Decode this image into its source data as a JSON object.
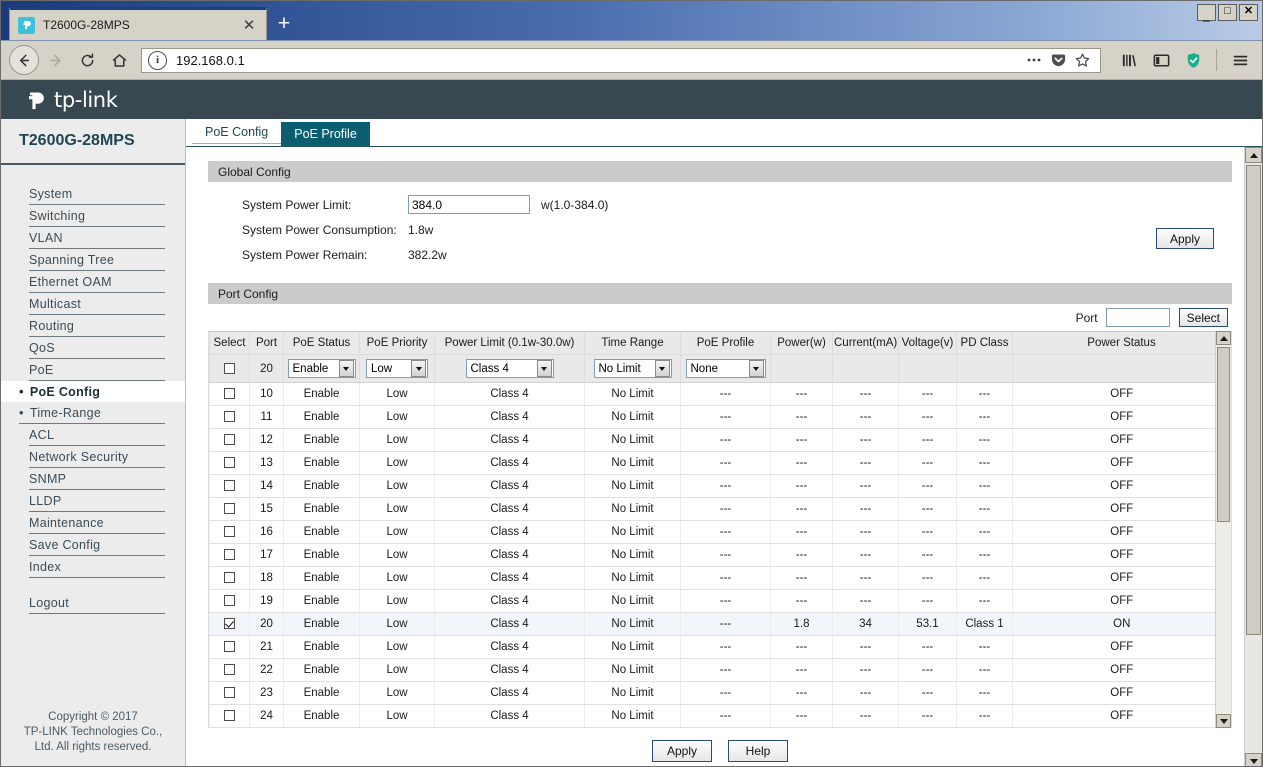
{
  "browser": {
    "tab_title": "T2600G-28MPS",
    "tab_close": "✕",
    "new_tab": "+",
    "url": "192.168.0.1",
    "minimize": "–",
    "maximize": "□",
    "close": "✕"
  },
  "brand": {
    "wordmark": "tp-link"
  },
  "sidebar": {
    "device_name": "T2600G-28MPS",
    "items": [
      {
        "label": "System",
        "type": "top"
      },
      {
        "label": "Switching",
        "type": "top"
      },
      {
        "label": "VLAN",
        "type": "top"
      },
      {
        "label": "Spanning Tree",
        "type": "top"
      },
      {
        "label": "Ethernet OAM",
        "type": "top"
      },
      {
        "label": "Multicast",
        "type": "top"
      },
      {
        "label": "Routing",
        "type": "top"
      },
      {
        "label": "QoS",
        "type": "top"
      },
      {
        "label": "PoE",
        "type": "top"
      },
      {
        "label": "PoE Config",
        "type": "sub-active",
        "bullet": "•"
      },
      {
        "label": "Time-Range",
        "type": "sub",
        "bullet": "•"
      },
      {
        "label": "ACL",
        "type": "top"
      },
      {
        "label": "Network Security",
        "type": "top"
      },
      {
        "label": "SNMP",
        "type": "top"
      },
      {
        "label": "LLDP",
        "type": "top"
      },
      {
        "label": "Maintenance",
        "type": "top"
      },
      {
        "label": "Save Config",
        "type": "top"
      },
      {
        "label": "Index",
        "type": "top"
      },
      {
        "label": "Logout",
        "type": "top-gap"
      }
    ],
    "copyright": "Copyright © 2017\nTP-LINK Technologies Co.,\nLtd. All rights reserved."
  },
  "tabs": [
    {
      "label": "PoE Config",
      "active": false
    },
    {
      "label": "PoE Profile",
      "active": true
    }
  ],
  "global_config": {
    "title": "Global Config",
    "power_limit_label": "System Power Limit:",
    "power_limit_value": "384.0",
    "power_limit_unit": "w(1.0-384.0)",
    "consumption_label": "System Power Consumption:",
    "consumption_value": "1.8w",
    "remain_label": "System Power Remain:",
    "remain_value": "382.2w",
    "apply_label": "Apply"
  },
  "port_config": {
    "title": "Port Config",
    "search_label": "Port",
    "search_value": "",
    "select_label": "Select",
    "columns": [
      "Select",
      "Port",
      "PoE Status",
      "PoE Priority",
      "Power Limit (0.1w-30.0w)",
      "Time Range",
      "PoE Profile",
      "Power(w)",
      "Current(mA)",
      "Voltage(v)",
      "PD Class",
      "Power Status"
    ],
    "edit_row": {
      "checked": false,
      "port": "20",
      "poe_status": "Enable",
      "poe_priority": "Low",
      "power_limit": "Class 4",
      "time_range": "No Limit",
      "poe_profile": "None"
    },
    "rows": [
      {
        "checked": false,
        "port": "10",
        "poe_status": "Enable",
        "poe_priority": "Low",
        "power_limit": "Class 4",
        "time_range": "No Limit",
        "poe_profile": "---",
        "power": "---",
        "current": "---",
        "voltage": "---",
        "pd_class": "---",
        "power_status": "OFF"
      },
      {
        "checked": false,
        "port": "11",
        "poe_status": "Enable",
        "poe_priority": "Low",
        "power_limit": "Class 4",
        "time_range": "No Limit",
        "poe_profile": "---",
        "power": "---",
        "current": "---",
        "voltage": "---",
        "pd_class": "---",
        "power_status": "OFF"
      },
      {
        "checked": false,
        "port": "12",
        "poe_status": "Enable",
        "poe_priority": "Low",
        "power_limit": "Class 4",
        "time_range": "No Limit",
        "poe_profile": "---",
        "power": "---",
        "current": "---",
        "voltage": "---",
        "pd_class": "---",
        "power_status": "OFF"
      },
      {
        "checked": false,
        "port": "13",
        "poe_status": "Enable",
        "poe_priority": "Low",
        "power_limit": "Class 4",
        "time_range": "No Limit",
        "poe_profile": "---",
        "power": "---",
        "current": "---",
        "voltage": "---",
        "pd_class": "---",
        "power_status": "OFF"
      },
      {
        "checked": false,
        "port": "14",
        "poe_status": "Enable",
        "poe_priority": "Low",
        "power_limit": "Class 4",
        "time_range": "No Limit",
        "poe_profile": "---",
        "power": "---",
        "current": "---",
        "voltage": "---",
        "pd_class": "---",
        "power_status": "OFF"
      },
      {
        "checked": false,
        "port": "15",
        "poe_status": "Enable",
        "poe_priority": "Low",
        "power_limit": "Class 4",
        "time_range": "No Limit",
        "poe_profile": "---",
        "power": "---",
        "current": "---",
        "voltage": "---",
        "pd_class": "---",
        "power_status": "OFF"
      },
      {
        "checked": false,
        "port": "16",
        "poe_status": "Enable",
        "poe_priority": "Low",
        "power_limit": "Class 4",
        "time_range": "No Limit",
        "poe_profile": "---",
        "power": "---",
        "current": "---",
        "voltage": "---",
        "pd_class": "---",
        "power_status": "OFF"
      },
      {
        "checked": false,
        "port": "17",
        "poe_status": "Enable",
        "poe_priority": "Low",
        "power_limit": "Class 4",
        "time_range": "No Limit",
        "poe_profile": "---",
        "power": "---",
        "current": "---",
        "voltage": "---",
        "pd_class": "---",
        "power_status": "OFF"
      },
      {
        "checked": false,
        "port": "18",
        "poe_status": "Enable",
        "poe_priority": "Low",
        "power_limit": "Class 4",
        "time_range": "No Limit",
        "poe_profile": "---",
        "power": "---",
        "current": "---",
        "voltage": "---",
        "pd_class": "---",
        "power_status": "OFF"
      },
      {
        "checked": false,
        "port": "19",
        "poe_status": "Enable",
        "poe_priority": "Low",
        "power_limit": "Class 4",
        "time_range": "No Limit",
        "poe_profile": "---",
        "power": "---",
        "current": "---",
        "voltage": "---",
        "pd_class": "---",
        "power_status": "OFF"
      },
      {
        "checked": true,
        "port": "20",
        "poe_status": "Enable",
        "poe_priority": "Low",
        "power_limit": "Class 4",
        "time_range": "No Limit",
        "poe_profile": "---",
        "power": "1.8",
        "current": "34",
        "voltage": "53.1",
        "pd_class": "Class 1",
        "power_status": "ON"
      },
      {
        "checked": false,
        "port": "21",
        "poe_status": "Enable",
        "poe_priority": "Low",
        "power_limit": "Class 4",
        "time_range": "No Limit",
        "poe_profile": "---",
        "power": "---",
        "current": "---",
        "voltage": "---",
        "pd_class": "---",
        "power_status": "OFF"
      },
      {
        "checked": false,
        "port": "22",
        "poe_status": "Enable",
        "poe_priority": "Low",
        "power_limit": "Class 4",
        "time_range": "No Limit",
        "poe_profile": "---",
        "power": "---",
        "current": "---",
        "voltage": "---",
        "pd_class": "---",
        "power_status": "OFF"
      },
      {
        "checked": false,
        "port": "23",
        "poe_status": "Enable",
        "poe_priority": "Low",
        "power_limit": "Class 4",
        "time_range": "No Limit",
        "poe_profile": "---",
        "power": "---",
        "current": "---",
        "voltage": "---",
        "pd_class": "---",
        "power_status": "OFF"
      },
      {
        "checked": false,
        "port": "24",
        "poe_status": "Enable",
        "poe_priority": "Low",
        "power_limit": "Class 4",
        "time_range": "No Limit",
        "poe_profile": "---",
        "power": "---",
        "current": "---",
        "voltage": "---",
        "pd_class": "---",
        "power_status": "OFF"
      }
    ]
  },
  "footer_buttons": {
    "apply": "Apply",
    "help": "Help"
  },
  "colors": {
    "brand_bar": "#374851",
    "active_tab": "#0b5d70",
    "device_name": "#1e4652",
    "titlebar_blue": "#28488c"
  }
}
